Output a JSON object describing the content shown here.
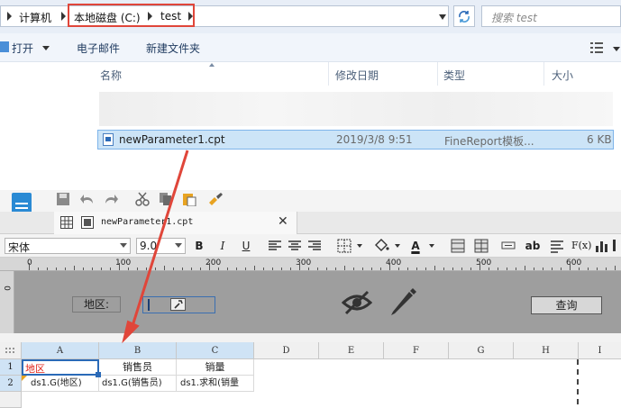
{
  "explorer": {
    "breadcrumbs": [
      "计算机",
      "本地磁盘 (C:)",
      "test"
    ],
    "search_placeholder": "搜索 test",
    "toolbar": {
      "open_label": "打开",
      "email_label": "电子邮件",
      "new_folder_label": "新建文件夹"
    },
    "columns": [
      "名称",
      "修改日期",
      "类型",
      "大小"
    ],
    "file": {
      "name": "newParameter1.cpt",
      "modified": "2019/3/8 9:51",
      "type": "FineReport模板...",
      "size": "6 KB"
    }
  },
  "designer": {
    "tab_label": "newParameter1.cpt",
    "font_name": "宋体",
    "font_size": "9.0",
    "fmt_buttons": {
      "bold": "B",
      "italic": "I",
      "underline": "U",
      "text_a": "A",
      "ab": "ab",
      "fx": "F(x)"
    },
    "ruler_marks": [
      "0",
      "100",
      "200",
      "300",
      "400",
      "500",
      "600"
    ],
    "vruler_mark": "0",
    "params": {
      "label": "地区:",
      "query_button": "查询"
    },
    "grid": {
      "columns": [
        "A",
        "B",
        "C",
        "D",
        "E",
        "F",
        "G",
        "H",
        "I"
      ],
      "rows": [
        "1",
        "2"
      ],
      "cells": {
        "A1": "地区",
        "B1": "销售员",
        "C1": "销量",
        "A2": "ds1.G(地区)",
        "B2": "ds1.G(销售员)",
        "C2": "ds1.求和(销量"
      }
    }
  },
  "colors": {
    "highlight": "#e0463a",
    "selection": "#cce4f7",
    "arrow": "#e0463a",
    "accent": "#2a6ab8"
  }
}
